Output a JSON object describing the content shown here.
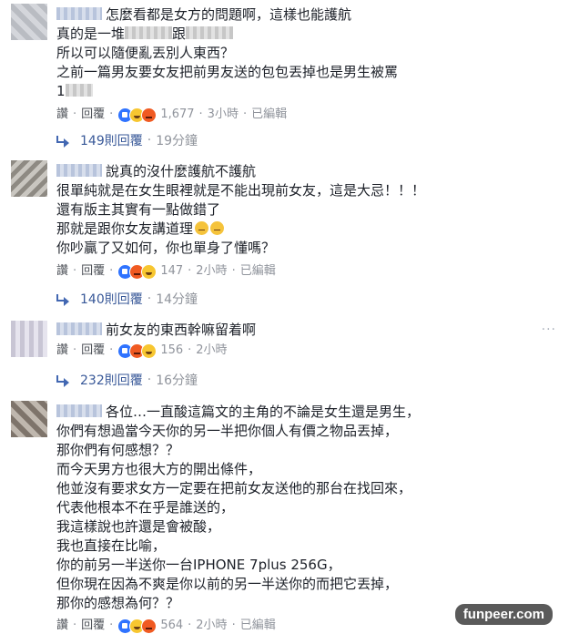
{
  "comments": [
    {
      "lines": [
        "怎麼看都是女方的問題啊，這樣也能護航",
        "真的是一堆",
        "跟",
        "所以可以隨便亂丟別人東西？",
        "之前一篇男友要女友把前男友送的包包丟掉也是男生被罵",
        "1"
      ],
      "like_label": "讚",
      "reply_label": "回覆",
      "reaction_count": "1,677",
      "time": "3小時",
      "edited": "已編輯",
      "replies_link": "149則回覆",
      "replies_time": "19分鐘"
    },
    {
      "lines": [
        "說真的沒什麼護航不護航",
        "很單純就是在女生眼裡就是不能出現前女友，這是大忌！！！",
        "還有版主其實有一點做錯了",
        "那就是跟你女友講道理",
        "你吵贏了又如何，你也單身了懂嗎？"
      ],
      "like_label": "讚",
      "reply_label": "回覆",
      "reaction_count": "147",
      "time": "2小時",
      "edited": "已編輯",
      "replies_link": "140則回覆",
      "replies_time": "14分鐘"
    },
    {
      "lines": [
        "前女友的東西幹嘛留着啊"
      ],
      "like_label": "讚",
      "reply_label": "回覆",
      "reaction_count": "156",
      "time": "2小時",
      "replies_link": "232則回覆",
      "replies_time": "16分鐘",
      "menu": "···"
    },
    {
      "lines": [
        "各位…一直酸這篇文的主角的不論是女生還是男生，",
        "你們有想過當今天你的另一半把你個人有價之物品丟掉，",
        "那你們有何感想？？",
        "而今天男方也很大方的開出條件，",
        "他並沒有要求女方一定要在把前女友送他的那台在找回來，",
        "代表他根本不在乎是誰送的，",
        "我這樣說也許還是會被酸，",
        "我也直接在比喻，",
        "你的前另一半送你一台IPHONE 7plus 256G，",
        "但你現在因為不爽是你以前的另一半送你的而把它丟掉，",
        "那你的感想為何？？"
      ],
      "like_label": "讚",
      "reply_label": "回覆",
      "reaction_count": "564",
      "time": "2小時",
      "edited": "已編輯"
    }
  ],
  "watermark": "funpeer.com",
  "icons": {
    "reaction_like": "like-reaction-icon",
    "reaction_haha": "haha-reaction-icon",
    "reaction_angry": "angry-reaction-icon",
    "reply_arrow": "reply-arrow-icon",
    "avatar": "avatar"
  }
}
